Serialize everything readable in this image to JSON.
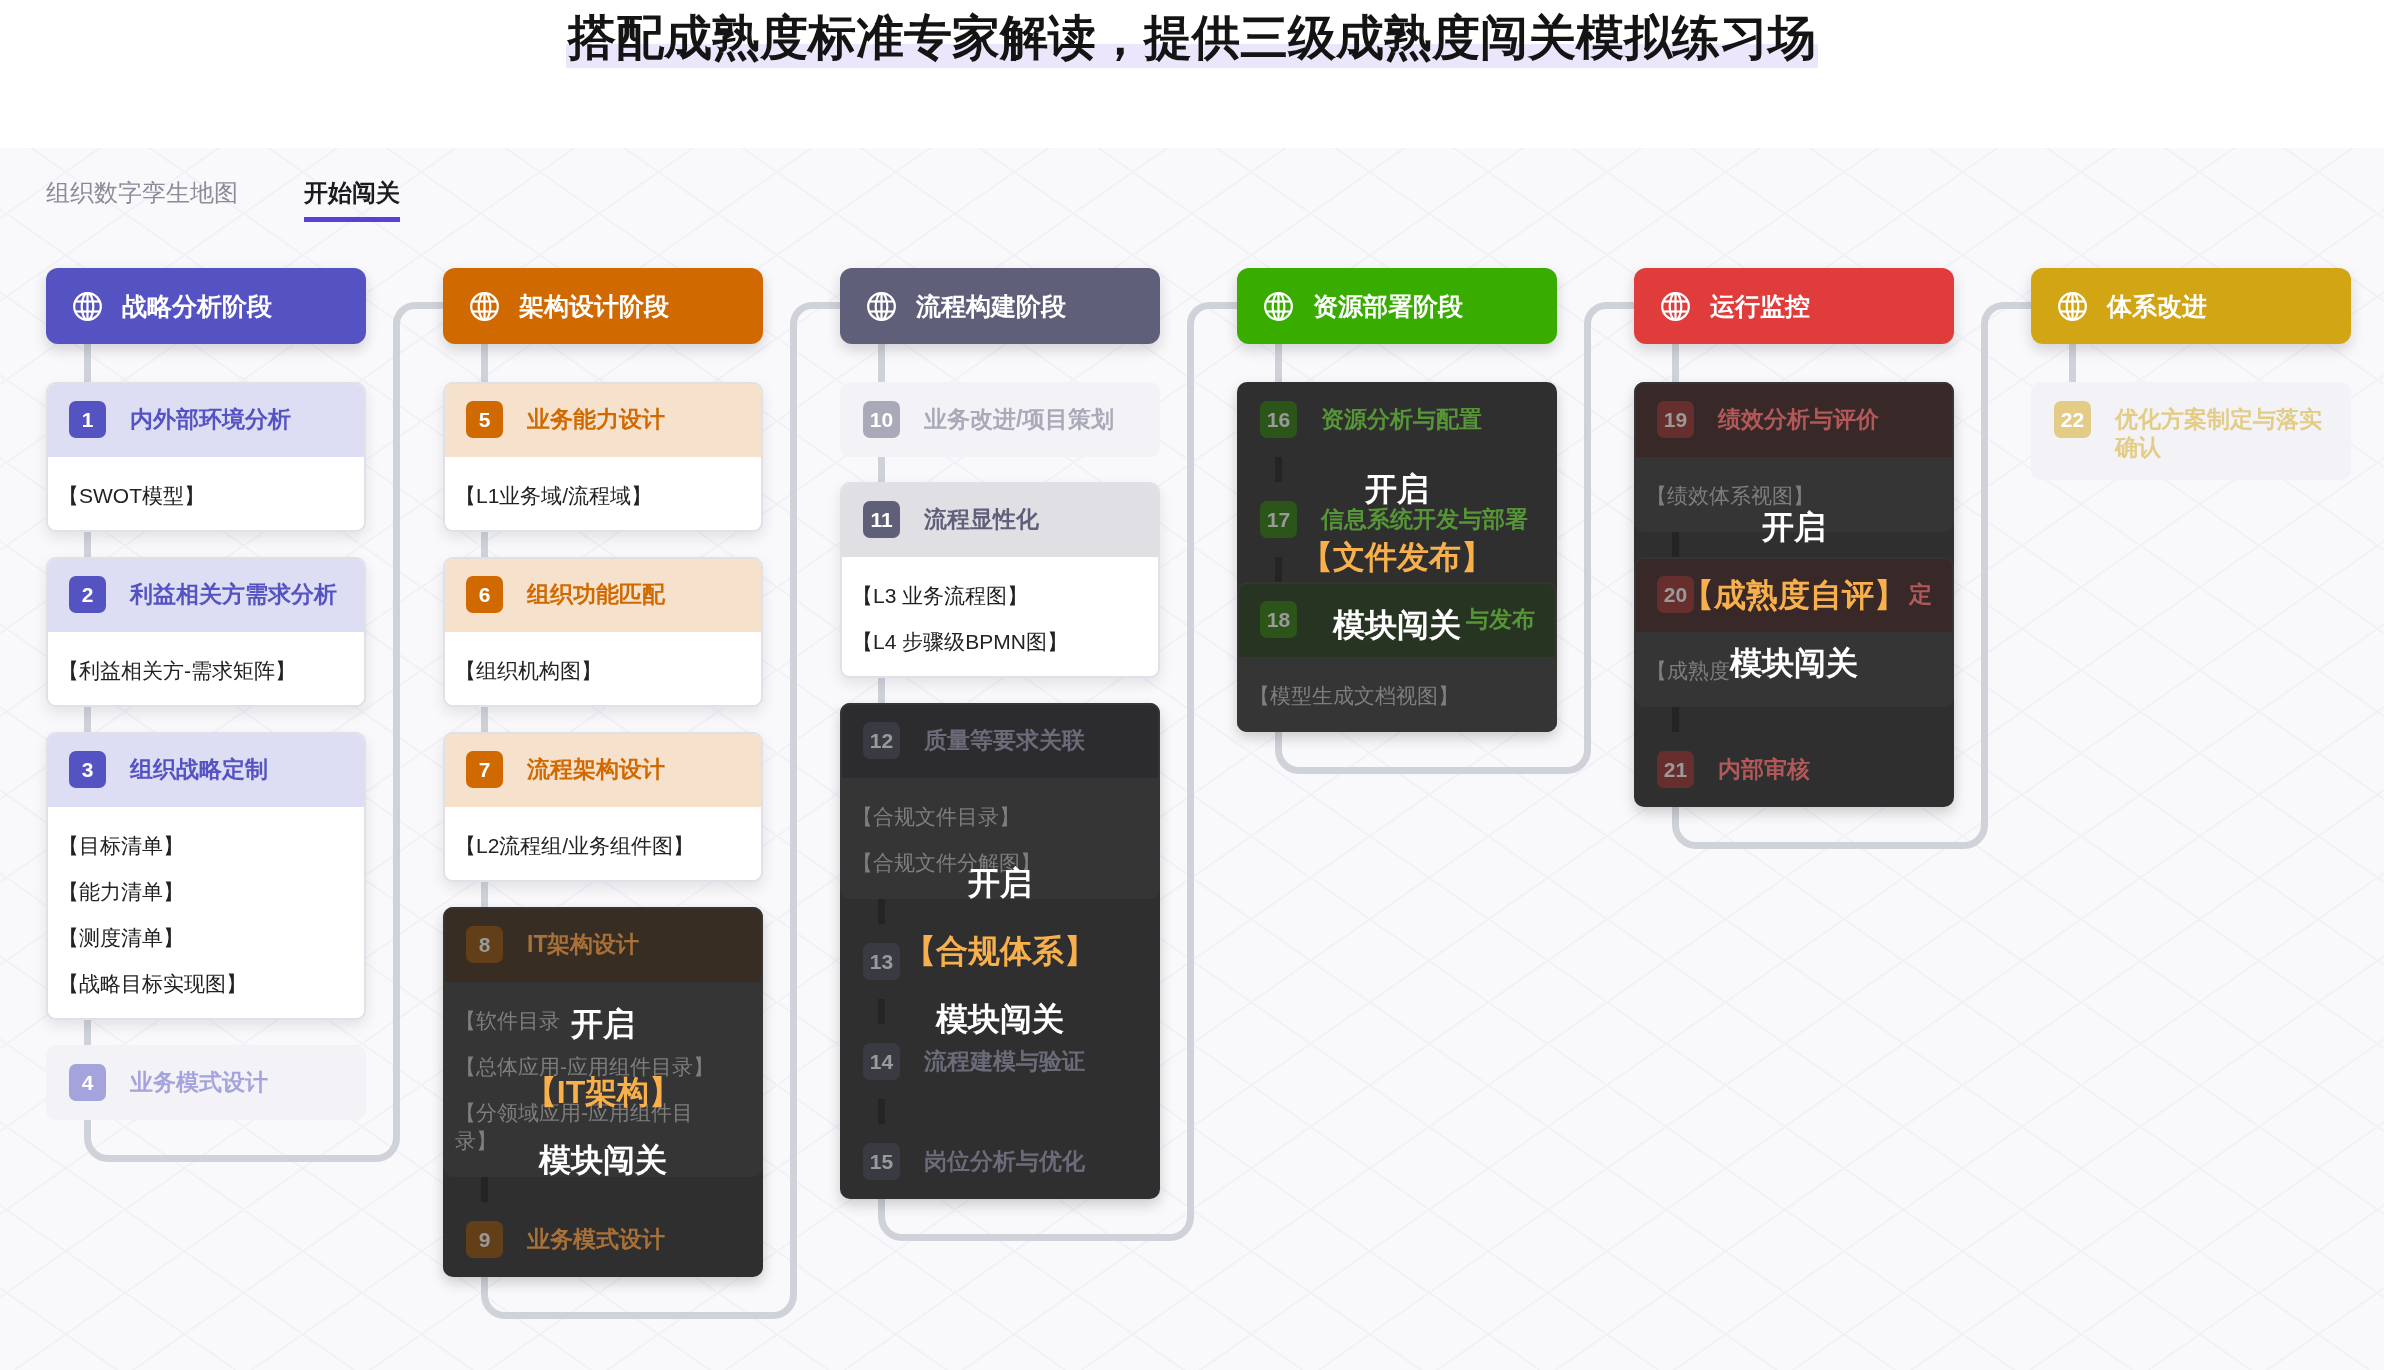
{
  "title": "搭配成熟度标准专家解读，提供三级成熟度闯关模拟练习场",
  "tabs": [
    {
      "label": "组织数字孪生地图",
      "selected": false
    },
    {
      "label": "开始闯关",
      "selected": true
    }
  ],
  "columns": [
    {
      "title": "战略分析阶段",
      "color": "#5553c2",
      "sections": [
        {
          "locked": false,
          "cards": [
            {
              "number": "1",
              "title": "内外部环境分析",
              "disabled": false,
              "items": [
                "【SWOT模型】"
              ]
            },
            {
              "number": "2",
              "title": "利益相关方需求分析",
              "disabled": false,
              "items": [
                "【利益相关方-需求矩阵】"
              ]
            },
            {
              "number": "3",
              "title": "组织战略定制",
              "disabled": false,
              "items": [
                "【目标清单】",
                "【能力清单】",
                "【测度清单】",
                "【战略目标实现图】"
              ]
            },
            {
              "number": "4",
              "title": "业务模式设计",
              "disabled": true
            }
          ]
        }
      ]
    },
    {
      "title": "架构设计阶段",
      "color": "#d06a00",
      "sections": [
        {
          "locked": false,
          "cards": [
            {
              "number": "5",
              "title": "业务能力设计",
              "disabled": false,
              "items": [
                "【L1业务域/流程域】"
              ]
            },
            {
              "number": "6",
              "title": "组织功能匹配",
              "disabled": false,
              "items": [
                "【组织机构图】"
              ]
            },
            {
              "number": "7",
              "title": "流程架构设计",
              "disabled": false,
              "items": [
                "【L2流程组/业务组件图】"
              ]
            }
          ]
        },
        {
          "locked": true,
          "overlay": {
            "action": "开启",
            "module": "【IT架构】",
            "label": "模块闯关"
          },
          "cards": [
            {
              "number": "8",
              "title": "IT架构设计",
              "disabled": false,
              "items": [
                "【软件目录",
                "【总体应用-应用组件目录】",
                "【分领域应用-应用组件目录】"
              ]
            },
            {
              "number": "9",
              "title": "业务模式设计",
              "disabled": true
            }
          ]
        }
      ]
    },
    {
      "title": "流程构建阶段",
      "color": "#5f5f7a",
      "sections": [
        {
          "locked": false,
          "cards": [
            {
              "number": "10",
              "title": "业务改进/项目策划",
              "disabled": true
            },
            {
              "number": "11",
              "title": "流程显性化",
              "disabled": false,
              "items": [
                "【L3 业务流程图】",
                "【L4 步骤级BPMN图】"
              ]
            }
          ]
        },
        {
          "locked": true,
          "overlay": {
            "action": "开启",
            "module": "【合规体系】",
            "label": "模块闯关"
          },
          "cards": [
            {
              "number": "12",
              "title": "质量等要求关联",
              "disabled": false,
              "items": [
                "【合规文件目录】",
                "【合规文件分解图】"
              ]
            },
            {
              "number": "13",
              "disabled": true
            },
            {
              "number": "14",
              "title": "流程建模与验证",
              "disabled": true
            },
            {
              "number": "15",
              "title": "岗位分析与优化",
              "disabled": true
            }
          ]
        }
      ]
    },
    {
      "title": "资源部署阶段",
      "color": "#38ad00",
      "sections": [
        {
          "locked": true,
          "overlay": {
            "action": "开启",
            "module": "【文件发布】",
            "label": "模块闯关"
          },
          "cards": [
            {
              "number": "16",
              "title": "资源分析与配置",
              "disabled": true
            },
            {
              "number": "17",
              "title": "信息系统开发与部署",
              "disabled": true
            },
            {
              "number": "18",
              "title": "与发布",
              "title_start_hidden": true,
              "disabled": false,
              "items": [
                "【模型生成文档视图】"
              ]
            }
          ]
        }
      ]
    },
    {
      "title": "运行监控",
      "color": "#e03c3c",
      "sections": [
        {
          "locked": true,
          "overlay": {
            "action": "开启",
            "module": "【成熟度自评】",
            "label": "模块闯关"
          },
          "cards": [
            {
              "number": "19",
              "title": "绩效分析与评价",
              "disabled": false,
              "items": [
                "【绩效体系视图】"
              ]
            },
            {
              "number": "20",
              "title": "定",
              "title_start_hidden": true,
              "disabled": false,
              "items": [
                "【成熟度"
              ]
            },
            {
              "number": "21",
              "title": "内部审核",
              "disabled": true
            }
          ]
        }
      ]
    },
    {
      "title": "体系改进",
      "color": "#d1a514",
      "sections": [
        {
          "locked": false,
          "cards": [
            {
              "number": "22",
              "title": "优化方案制定与落实确认",
              "disabled": true
            }
          ]
        }
      ]
    }
  ]
}
